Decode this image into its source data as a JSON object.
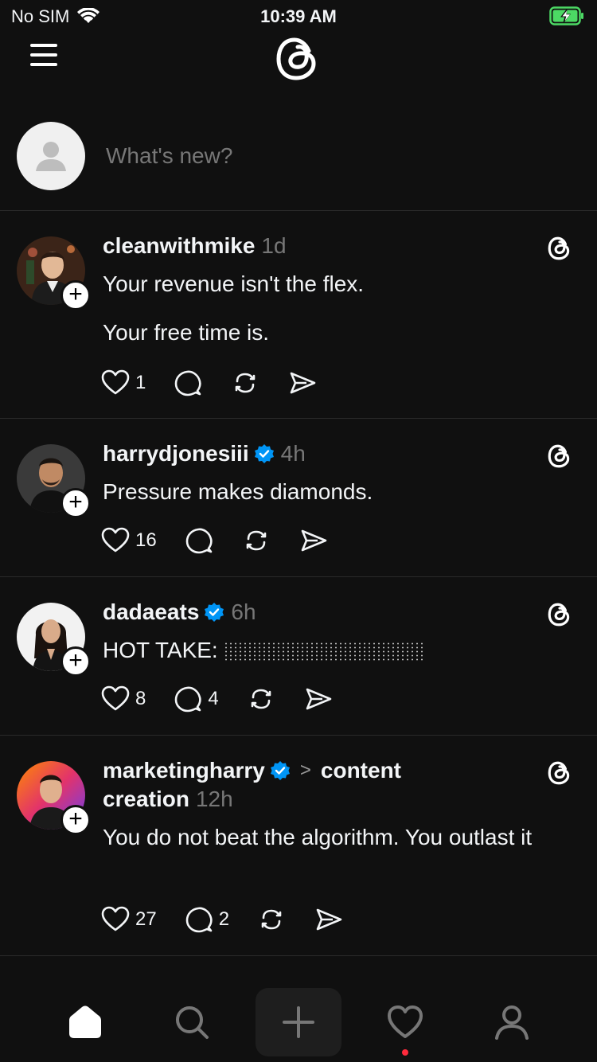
{
  "status_bar": {
    "carrier": "No SIM",
    "time": "10:39 AM"
  },
  "composer": {
    "placeholder": "What's new?"
  },
  "posts": [
    {
      "username": "cleanwithmike",
      "verified": false,
      "time": "1d",
      "lines": [
        "Your revenue isn't the flex.",
        "Your free time is."
      ],
      "likes": "1",
      "replies": ""
    },
    {
      "username": "harrydjonesiii",
      "verified": true,
      "time": "4h",
      "lines": [
        "Pressure makes diamonds."
      ],
      "likes": "16",
      "replies": ""
    },
    {
      "username": "dadaeats",
      "verified": true,
      "time": "6h",
      "lines": [
        "HOT TAKE:"
      ],
      "likes": "8",
      "replies": "4"
    },
    {
      "username": "marketingharry",
      "verified": true,
      "topic_arrow": ">",
      "topic": "content",
      "topic_line2": "creation",
      "time": "12h",
      "lines": [
        "You do not beat the algorithm. You outlast it"
      ],
      "likes": "27",
      "replies": "2"
    }
  ],
  "colors": {
    "background": "#101010",
    "text": "#f3f5f7",
    "muted": "#777777",
    "verified": "#0095f6",
    "notification_dot": "#ff2a3c"
  },
  "nav": {
    "items": [
      "home-icon",
      "search-icon",
      "plus-icon",
      "heart-icon",
      "profile-icon"
    ]
  }
}
